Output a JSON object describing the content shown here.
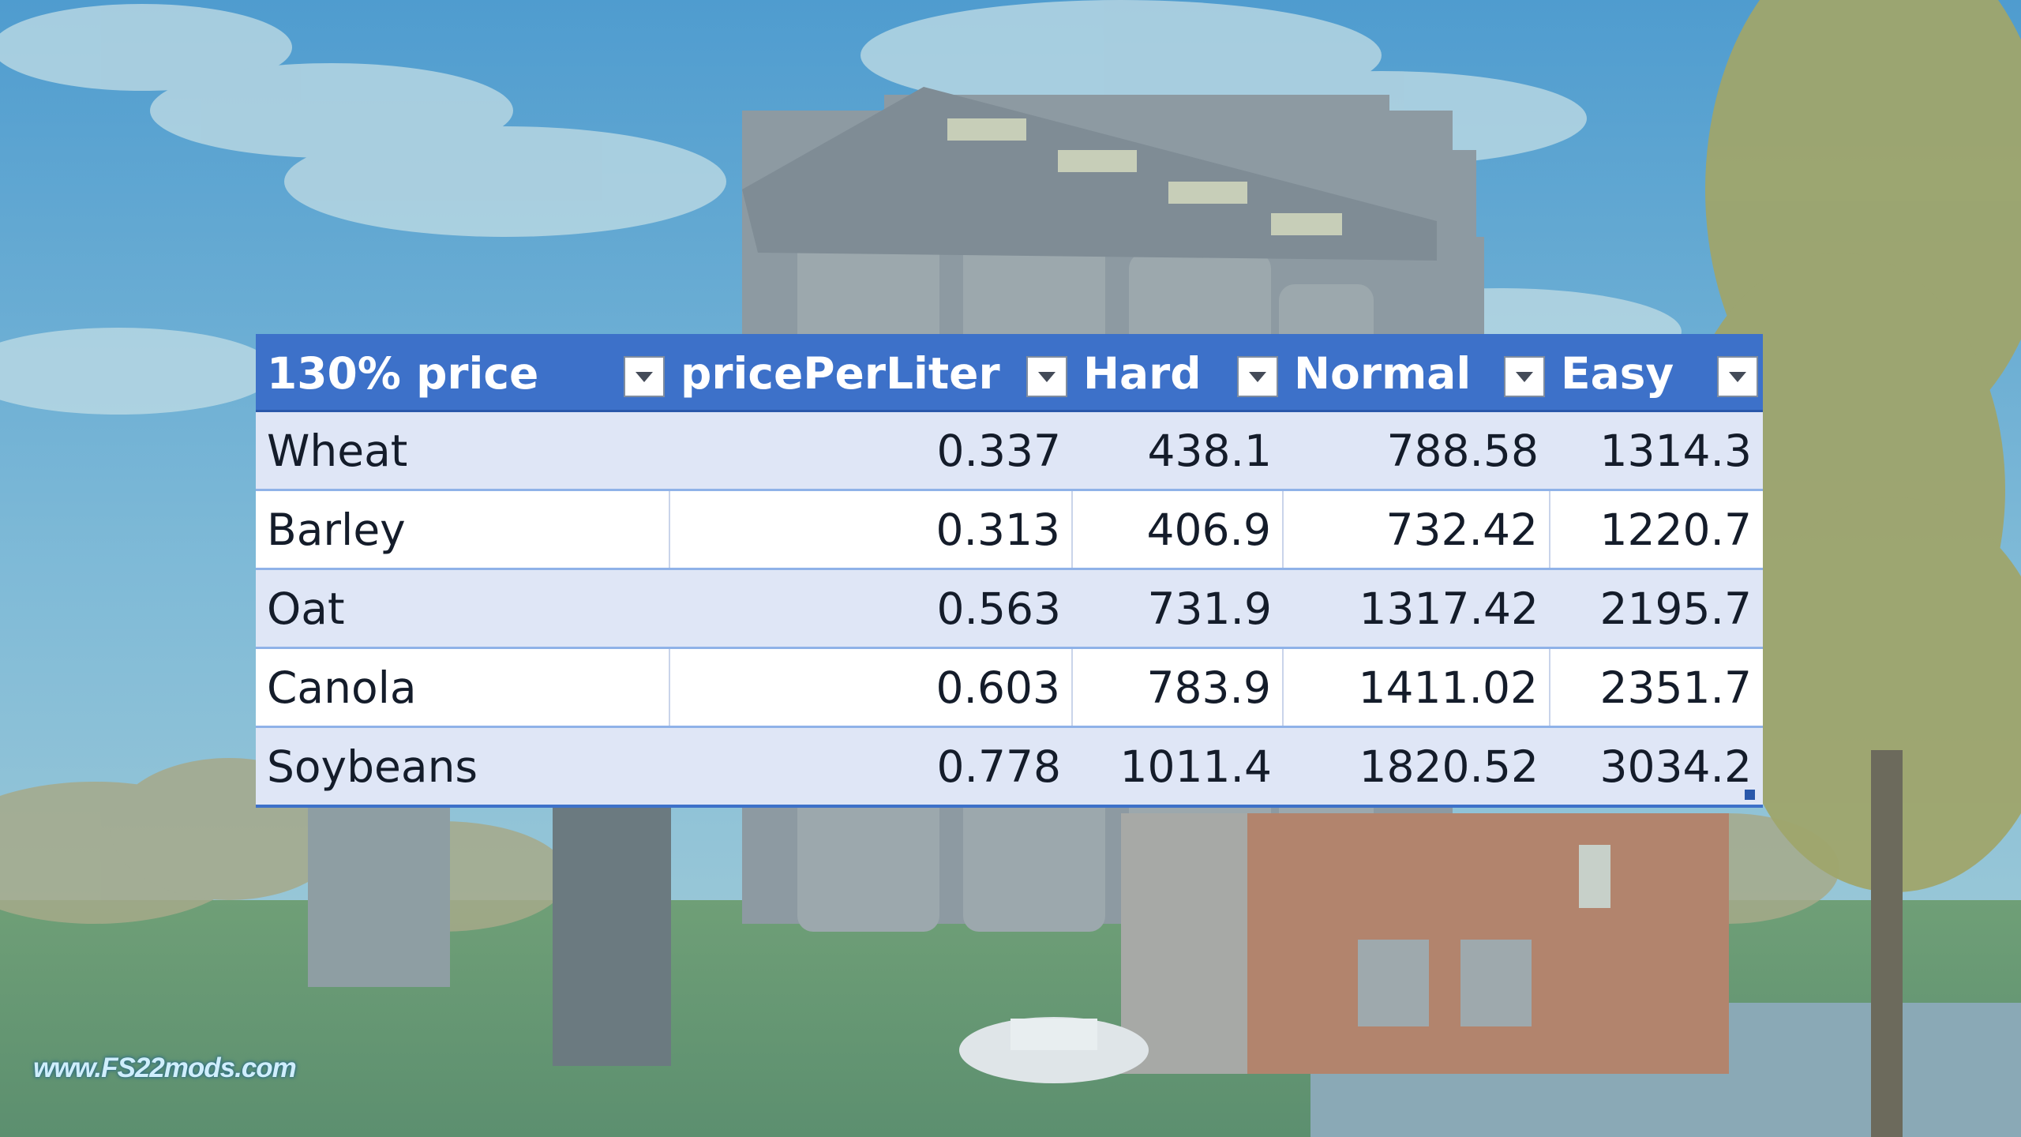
{
  "table": {
    "columns": [
      {
        "label": "130% price"
      },
      {
        "label": "pricePerLiter"
      },
      {
        "label": "Hard"
      },
      {
        "label": "Normal"
      },
      {
        "label": "Easy"
      }
    ],
    "rows": [
      {
        "cells": [
          "Wheat",
          "0.337",
          "438.1",
          "788.58",
          "1314.3"
        ]
      },
      {
        "cells": [
          "Barley",
          "0.313",
          "406.9",
          "732.42",
          "1220.7"
        ]
      },
      {
        "cells": [
          "Oat",
          "0.563",
          "731.9",
          "1317.42",
          "2195.7"
        ]
      },
      {
        "cells": [
          "Canola",
          "0.603",
          "783.9",
          "1411.02",
          "2351.7"
        ]
      },
      {
        "cells": [
          "Soybeans",
          "0.778",
          "1011.4",
          "1820.52",
          "3034.2"
        ]
      }
    ],
    "header_color": "#3d71c9",
    "band_color": "#dfe6f6"
  },
  "watermark": {
    "text": "www.FS22mods.com"
  },
  "background": {
    "tint": "#6fb4cf"
  },
  "icons": {
    "filter": "filter-dropdown-icon"
  }
}
